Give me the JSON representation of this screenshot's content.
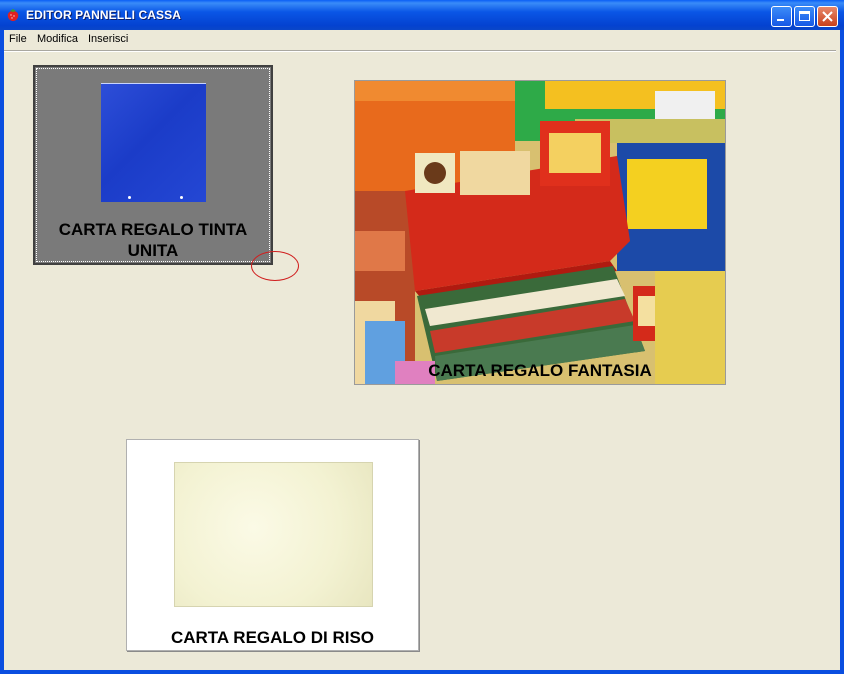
{
  "window": {
    "title": "EDITOR PANNELLI CASSA",
    "icon": "strawberry-app-icon",
    "controls": [
      "minimize-icon",
      "maximize-icon",
      "close-icon"
    ]
  },
  "menu": {
    "items": [
      "File",
      "Modifica",
      "Inserisci"
    ]
  },
  "panels": {
    "tinta_unita": {
      "label": "CARTA REGALO TINTA UNITA",
      "image": "blue-gift-paper"
    },
    "fantasia": {
      "label": "CARTA REGALO FANTASIA",
      "image": "gift-paper-display-box"
    },
    "riso": {
      "label": "CARTA REGALO DI RISO",
      "image": "rice-paper-sheet"
    }
  },
  "colors": {
    "title_bar": "#0a56e6",
    "client_bg": "#ece9d8",
    "selected_panel_bg": "#7a7a7a",
    "blue_paper": "#1b3cc8",
    "annotation_circle": "#d02020"
  }
}
